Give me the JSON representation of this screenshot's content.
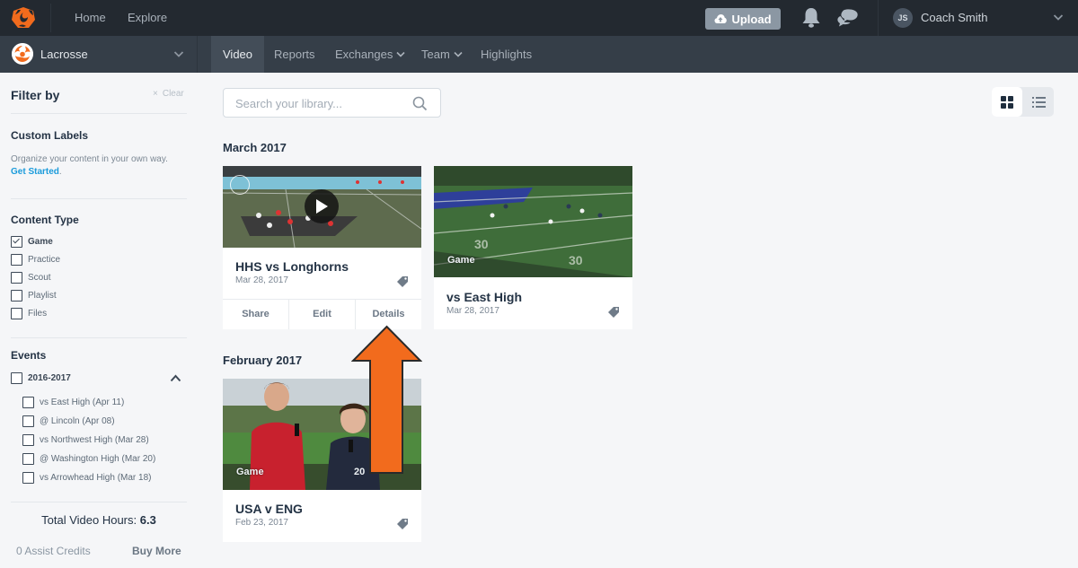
{
  "topbar": {
    "logo_icon": "hudl-logo-icon",
    "nav": [
      "Home",
      "Explore"
    ],
    "upload_label": "Upload",
    "notifications_icon": "bell-icon",
    "messages_icon": "chat-bubbles-icon",
    "user": {
      "initials": "JS",
      "name": "Coach Smith"
    }
  },
  "subbar": {
    "team_name": "Lacrosse",
    "tabs": [
      {
        "label": "Video",
        "active": true,
        "dropdown": false
      },
      {
        "label": "Reports",
        "active": false,
        "dropdown": false
      },
      {
        "label": "Exchanges",
        "active": false,
        "dropdown": true
      },
      {
        "label": "Team",
        "active": false,
        "dropdown": true
      },
      {
        "label": "Highlights",
        "active": false,
        "dropdown": false
      }
    ]
  },
  "sidebar": {
    "title": "Filter by",
    "clear_label": "Clear",
    "custom_labels": {
      "title": "Custom Labels",
      "description": "Organize your content in your own way.",
      "link": "Get Started",
      "link_suffix": "."
    },
    "content_type": {
      "title": "Content Type",
      "options": [
        {
          "label": "Game",
          "checked": true
        },
        {
          "label": "Practice",
          "checked": false
        },
        {
          "label": "Scout",
          "checked": false
        },
        {
          "label": "Playlist",
          "checked": false
        },
        {
          "label": "Files",
          "checked": false
        }
      ]
    },
    "events": {
      "title": "Events",
      "season": {
        "label": "2016-2017",
        "checked": false,
        "expanded": true
      },
      "items": [
        {
          "label": "vs East High (Apr 11)",
          "checked": false
        },
        {
          "label": "@ Lincoln (Apr 08)",
          "checked": false
        },
        {
          "label": "vs Northwest High (Mar 28)",
          "checked": false
        },
        {
          "label": "@ Washington High (Mar 20)",
          "checked": false
        },
        {
          "label": "vs Arrowhead High (Mar 18)",
          "checked": false
        }
      ]
    },
    "total_label": "Total Video Hours:",
    "total_value": "6.3",
    "credits": "0 Assist Credits",
    "buy_more": "Buy More"
  },
  "main": {
    "search": {
      "placeholder": "Search your library...",
      "value": ""
    },
    "view_modes": [
      {
        "name": "grid",
        "active": true
      },
      {
        "name": "list",
        "active": false
      }
    ],
    "groups": [
      {
        "title": "March 2017",
        "cards": [
          {
            "title": "HHS vs Longhorns",
            "date": "Mar 28, 2017",
            "hovered": true,
            "actions": [
              "Share",
              "Edit",
              "Details"
            ]
          },
          {
            "title": "vs East High",
            "date": "Mar 28, 2017",
            "thumb_label": "Game"
          }
        ]
      },
      {
        "title": "February 2017",
        "cards": [
          {
            "title": "USA v ENG",
            "date": "Feb 23, 2017",
            "thumb_label": "Game",
            "thumb_duration": "20"
          }
        ]
      }
    ]
  },
  "annotation": {
    "type": "arrow-up",
    "color": "#f26b1d",
    "points_to": "Details"
  },
  "colors": {
    "topbar": "#232930",
    "subbar": "#353e48",
    "accent_orange": "#f26b1d",
    "link_blue": "#1a9bdb",
    "text_dark": "#243345"
  }
}
